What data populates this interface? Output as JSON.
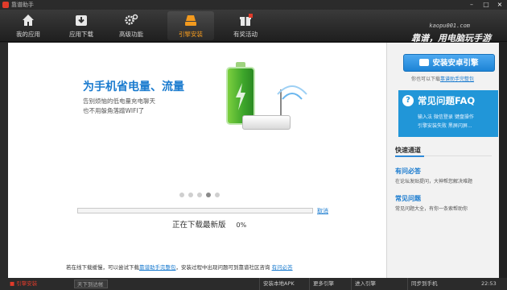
{
  "window": {
    "title": "靠谱助手",
    "controls": {
      "min": "–",
      "max": "□",
      "close": "×"
    }
  },
  "nav": {
    "items": [
      {
        "label": "我的应用",
        "icon": "home-icon"
      },
      {
        "label": "应用下载",
        "icon": "download-box-icon"
      },
      {
        "label": "高级功能",
        "icon": "gears-icon"
      },
      {
        "label": "引擎安装",
        "icon": "engine-icon",
        "active": true
      },
      {
        "label": "有奖活动",
        "icon": "gift-icon"
      }
    ],
    "brand_url": "kaopu001.com",
    "brand_slogan": "靠谱，用电脑玩手游"
  },
  "banner": {
    "title": "为手机省电量、流量",
    "subtitle_1": "告别烦恼的低电量充电聊天",
    "subtitle_2": "也不用躲角落蹭WIFI了",
    "dots_total": 5,
    "dots_active_index": 3
  },
  "download": {
    "progress_fraction": 0.0,
    "cancel_label": "取消",
    "status_text": "正在下载最新版",
    "percent_text": "0%"
  },
  "footer_note": {
    "prefix": "若在线下载缓慢，可以尝试下载",
    "link1": "靠谱助手完整包",
    "middle": "，安装过程中出现问题可到靠谱社区咨询",
    "link2": "有问必答"
  },
  "right_panel": {
    "install_button": "安装安卓引擎",
    "install_hint_prefix": "你也可以下载",
    "install_hint_link": "靠谱助手完整包",
    "faq": {
      "title": "常见问题FAQ",
      "line1": "输入法  微信登录  键盘操作",
      "line2": "引擎安装失败  黑屏闪屏..."
    },
    "quick_title": "快速通道",
    "qa": [
      {
        "title": "有问必答",
        "desc": "在论坛发贴提问，大神帮您解决难题"
      },
      {
        "title": "常见问题",
        "desc": "常见问题大全，有你一条索帮助你"
      }
    ]
  },
  "bottom_bar": {
    "left_label": "■ 引擎安装",
    "select_value": "天下到达帐",
    "buttons": [
      "安装本地APK",
      "更多引擎",
      "进入引擎",
      "同步到手机"
    ],
    "time": "22:53"
  }
}
